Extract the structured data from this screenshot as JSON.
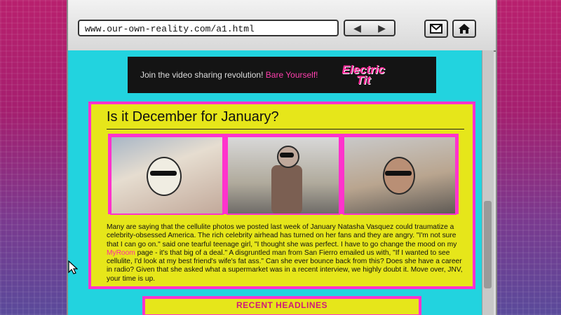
{
  "browser": {
    "address": "www.our-own-reality.com/a1.html",
    "back_icon": "◀",
    "forward_icon": "▶",
    "mail_icon": "mail-icon",
    "home_icon": "home-icon"
  },
  "banner": {
    "text_prefix": "Join the video sharing revolution!",
    "text_link": "Bare Yourself!",
    "logo_line1": "Electric",
    "logo_line2": "Tit"
  },
  "article": {
    "title": "Is it December for January?",
    "body_part1": "Many are saying that the cellulite photos we posted last week of January Natasha Vasquez could traumatize a celebrity-obsessed America.  The rich celebrity airhead has turned on her fans and they are angry.  \"I'm not sure that I can go on.\" said one tearful teenage girl, \"I thought she was perfect.  I have to go change the mood on my ",
    "body_link": "MyRoom",
    "body_part2": " page - it's that big of a deal.\"   A disgruntled man from San Fierro emailed us with, \"If I wanted to see cellulite, I'd look at my best friend's wife's fat ass.\"  Can she ever bounce back from this?  Does she have a career in radio? Given that she asked what a supermarket was in a recent interview, we highly doubt it.  Move over, JNV, your time is up."
  },
  "headlines": {
    "title": "RECENT HEADLINES"
  },
  "colors": {
    "page_bg": "#22d3df",
    "card_yellow": "#e6e61a",
    "accent_pink": "#ff33cc",
    "side_magenta": "#b8206e"
  }
}
